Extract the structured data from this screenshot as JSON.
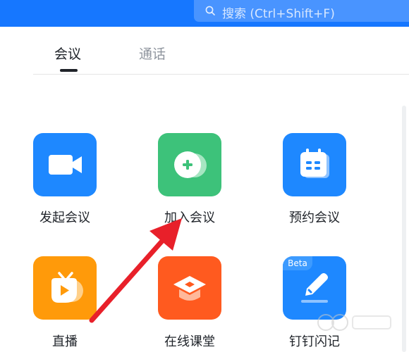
{
  "search": {
    "placeholder": "搜索 (Ctrl+Shift+F)",
    "icon": "search-icon"
  },
  "tabs": [
    {
      "label": "会议",
      "active": true
    },
    {
      "label": "通话",
      "active": false
    }
  ],
  "actions": [
    {
      "label": "发起会议",
      "icon": "video-camera-icon",
      "color": "#1e88ff"
    },
    {
      "label": "加入会议",
      "icon": "plus-circle-icon",
      "color": "#3dc27a"
    },
    {
      "label": "预约会议",
      "icon": "calendar-icon",
      "color": "#1e88ff"
    },
    {
      "label": "直播",
      "icon": "live-tv-icon",
      "color": "#ff9a0a"
    },
    {
      "label": "在线课堂",
      "icon": "graduation-cap-icon",
      "color": "#ff5a1f"
    },
    {
      "label": "钉钉闪记",
      "icon": "pen-note-icon",
      "color": "#1e88ff",
      "badge": "Beta"
    }
  ],
  "colors": {
    "topbar": "#1677ff",
    "annotation_arrow": "#e8202a"
  }
}
